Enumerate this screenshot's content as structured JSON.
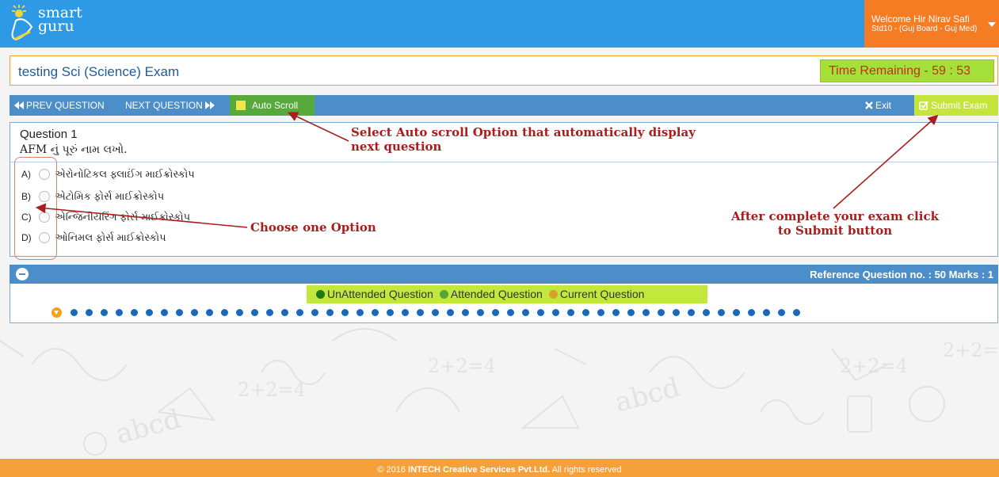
{
  "header": {
    "logo_line1": "smart",
    "logo_line2": "guru",
    "welcome": "Welcome Hir Nirav Safi",
    "std": "Std10 - (Guj Board - Guj Med)"
  },
  "exam": {
    "title": "testing Sci (Science) Exam",
    "timer": "Time Remaining - 59 : 53"
  },
  "toolbar": {
    "prev": "PREV QUESTION",
    "next": "NEXT QUESTION",
    "auto_scroll": "Auto Scroll",
    "exit": "Exit",
    "submit": "Submit Exam"
  },
  "question": {
    "number": "Question 1",
    "text": "AFM નું પૂરું નામ લખો.",
    "options": [
      {
        "letter": "A)",
        "text": "એરોનોટિકલ ફ્લાઈંગ માઈક્રોસ્કોપ"
      },
      {
        "letter": "B)",
        "text": "એટોમિક ફોર્સ માઈક્રોસ્કોપ"
      },
      {
        "letter": "C)",
        "text": "એન્જિનીયરિંગ ફોર્સ માઈક્રોસ્કોપ"
      },
      {
        "letter": "D)",
        "text": "ઓનિમલ ફોર્સ માઈક્રોસ્કોપ"
      }
    ]
  },
  "reference": {
    "text": "Reference Question no. : 50   Marks : 1"
  },
  "legend": {
    "unattended": "UnAttended Question",
    "attended": "Attended Question",
    "current": "Current Question"
  },
  "pager": {
    "question_count": 50,
    "current_index": 1
  },
  "annotations": {
    "auto_scroll_note": "Select Auto scroll Option that automatically display next question",
    "choose_option": "Choose one Option",
    "submit_note": "After complete your exam click to Submit button"
  },
  "footer": {
    "prefix": "© 2016 ",
    "company": "INTECH Creative Services Pvt.Ltd.",
    "suffix": " All rights reserved"
  },
  "colors": {
    "header_blue": "#2e9ae6",
    "accent_orange": "#f57c23",
    "nav_blue": "#4b8ec9",
    "timer_green": "#a4e03a",
    "annotation_red": "#a91d1d"
  }
}
